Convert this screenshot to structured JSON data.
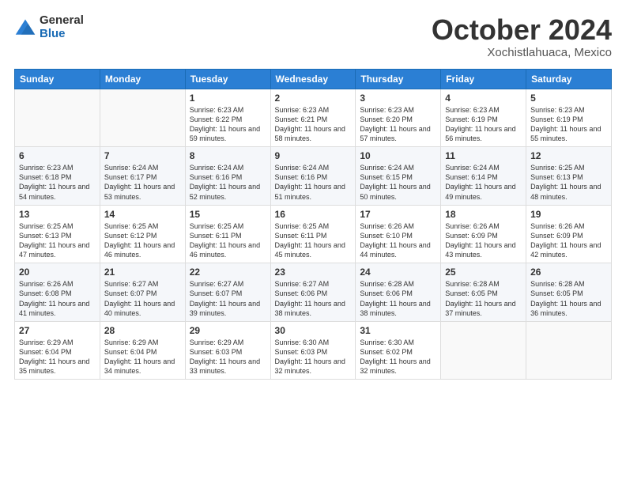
{
  "logo": {
    "general": "General",
    "blue": "Blue"
  },
  "title": {
    "month": "October 2024",
    "location": "Xochistlahuaca, Mexico"
  },
  "weekdays": [
    "Sunday",
    "Monday",
    "Tuesday",
    "Wednesday",
    "Thursday",
    "Friday",
    "Saturday"
  ],
  "weeks": [
    [
      {
        "day": "",
        "sunrise": "",
        "sunset": "",
        "daylight": ""
      },
      {
        "day": "",
        "sunrise": "",
        "sunset": "",
        "daylight": ""
      },
      {
        "day": "1",
        "sunrise": "Sunrise: 6:23 AM",
        "sunset": "Sunset: 6:22 PM",
        "daylight": "Daylight: 11 hours and 59 minutes."
      },
      {
        "day": "2",
        "sunrise": "Sunrise: 6:23 AM",
        "sunset": "Sunset: 6:21 PM",
        "daylight": "Daylight: 11 hours and 58 minutes."
      },
      {
        "day": "3",
        "sunrise": "Sunrise: 6:23 AM",
        "sunset": "Sunset: 6:20 PM",
        "daylight": "Daylight: 11 hours and 57 minutes."
      },
      {
        "day": "4",
        "sunrise": "Sunrise: 6:23 AM",
        "sunset": "Sunset: 6:19 PM",
        "daylight": "Daylight: 11 hours and 56 minutes."
      },
      {
        "day": "5",
        "sunrise": "Sunrise: 6:23 AM",
        "sunset": "Sunset: 6:19 PM",
        "daylight": "Daylight: 11 hours and 55 minutes."
      }
    ],
    [
      {
        "day": "6",
        "sunrise": "Sunrise: 6:23 AM",
        "sunset": "Sunset: 6:18 PM",
        "daylight": "Daylight: 11 hours and 54 minutes."
      },
      {
        "day": "7",
        "sunrise": "Sunrise: 6:24 AM",
        "sunset": "Sunset: 6:17 PM",
        "daylight": "Daylight: 11 hours and 53 minutes."
      },
      {
        "day": "8",
        "sunrise": "Sunrise: 6:24 AM",
        "sunset": "Sunset: 6:16 PM",
        "daylight": "Daylight: 11 hours and 52 minutes."
      },
      {
        "day": "9",
        "sunrise": "Sunrise: 6:24 AM",
        "sunset": "Sunset: 6:16 PM",
        "daylight": "Daylight: 11 hours and 51 minutes."
      },
      {
        "day": "10",
        "sunrise": "Sunrise: 6:24 AM",
        "sunset": "Sunset: 6:15 PM",
        "daylight": "Daylight: 11 hours and 50 minutes."
      },
      {
        "day": "11",
        "sunrise": "Sunrise: 6:24 AM",
        "sunset": "Sunset: 6:14 PM",
        "daylight": "Daylight: 11 hours and 49 minutes."
      },
      {
        "day": "12",
        "sunrise": "Sunrise: 6:25 AM",
        "sunset": "Sunset: 6:13 PM",
        "daylight": "Daylight: 11 hours and 48 minutes."
      }
    ],
    [
      {
        "day": "13",
        "sunrise": "Sunrise: 6:25 AM",
        "sunset": "Sunset: 6:13 PM",
        "daylight": "Daylight: 11 hours and 47 minutes."
      },
      {
        "day": "14",
        "sunrise": "Sunrise: 6:25 AM",
        "sunset": "Sunset: 6:12 PM",
        "daylight": "Daylight: 11 hours and 46 minutes."
      },
      {
        "day": "15",
        "sunrise": "Sunrise: 6:25 AM",
        "sunset": "Sunset: 6:11 PM",
        "daylight": "Daylight: 11 hours and 46 minutes."
      },
      {
        "day": "16",
        "sunrise": "Sunrise: 6:25 AM",
        "sunset": "Sunset: 6:11 PM",
        "daylight": "Daylight: 11 hours and 45 minutes."
      },
      {
        "day": "17",
        "sunrise": "Sunrise: 6:26 AM",
        "sunset": "Sunset: 6:10 PM",
        "daylight": "Daylight: 11 hours and 44 minutes."
      },
      {
        "day": "18",
        "sunrise": "Sunrise: 6:26 AM",
        "sunset": "Sunset: 6:09 PM",
        "daylight": "Daylight: 11 hours and 43 minutes."
      },
      {
        "day": "19",
        "sunrise": "Sunrise: 6:26 AM",
        "sunset": "Sunset: 6:09 PM",
        "daylight": "Daylight: 11 hours and 42 minutes."
      }
    ],
    [
      {
        "day": "20",
        "sunrise": "Sunrise: 6:26 AM",
        "sunset": "Sunset: 6:08 PM",
        "daylight": "Daylight: 11 hours and 41 minutes."
      },
      {
        "day": "21",
        "sunrise": "Sunrise: 6:27 AM",
        "sunset": "Sunset: 6:07 PM",
        "daylight": "Daylight: 11 hours and 40 minutes."
      },
      {
        "day": "22",
        "sunrise": "Sunrise: 6:27 AM",
        "sunset": "Sunset: 6:07 PM",
        "daylight": "Daylight: 11 hours and 39 minutes."
      },
      {
        "day": "23",
        "sunrise": "Sunrise: 6:27 AM",
        "sunset": "Sunset: 6:06 PM",
        "daylight": "Daylight: 11 hours and 38 minutes."
      },
      {
        "day": "24",
        "sunrise": "Sunrise: 6:28 AM",
        "sunset": "Sunset: 6:06 PM",
        "daylight": "Daylight: 11 hours and 38 minutes."
      },
      {
        "day": "25",
        "sunrise": "Sunrise: 6:28 AM",
        "sunset": "Sunset: 6:05 PM",
        "daylight": "Daylight: 11 hours and 37 minutes."
      },
      {
        "day": "26",
        "sunrise": "Sunrise: 6:28 AM",
        "sunset": "Sunset: 6:05 PM",
        "daylight": "Daylight: 11 hours and 36 minutes."
      }
    ],
    [
      {
        "day": "27",
        "sunrise": "Sunrise: 6:29 AM",
        "sunset": "Sunset: 6:04 PM",
        "daylight": "Daylight: 11 hours and 35 minutes."
      },
      {
        "day": "28",
        "sunrise": "Sunrise: 6:29 AM",
        "sunset": "Sunset: 6:04 PM",
        "daylight": "Daylight: 11 hours and 34 minutes."
      },
      {
        "day": "29",
        "sunrise": "Sunrise: 6:29 AM",
        "sunset": "Sunset: 6:03 PM",
        "daylight": "Daylight: 11 hours and 33 minutes."
      },
      {
        "day": "30",
        "sunrise": "Sunrise: 6:30 AM",
        "sunset": "Sunset: 6:03 PM",
        "daylight": "Daylight: 11 hours and 32 minutes."
      },
      {
        "day": "31",
        "sunrise": "Sunrise: 6:30 AM",
        "sunset": "Sunset: 6:02 PM",
        "daylight": "Daylight: 11 hours and 32 minutes."
      },
      {
        "day": "",
        "sunrise": "",
        "sunset": "",
        "daylight": ""
      },
      {
        "day": "",
        "sunrise": "",
        "sunset": "",
        "daylight": ""
      }
    ]
  ]
}
